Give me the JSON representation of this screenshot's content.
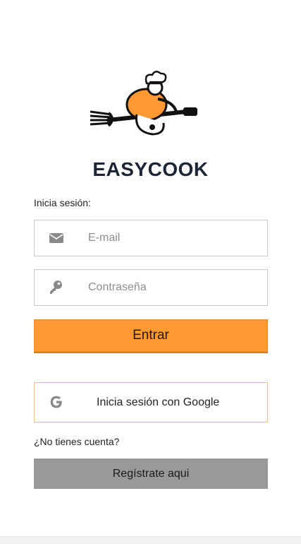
{
  "app": {
    "title": "EASYCOOK"
  },
  "login": {
    "label": "Inicia sesión:"
  },
  "email": {
    "placeholder": "E-mail",
    "icon": "envelope-icon"
  },
  "password": {
    "placeholder": "Contraseña",
    "icon": "key-icon"
  },
  "buttons": {
    "enter_label": "Entrar",
    "google_label": "Inicia sesión con Google",
    "register_label": "Regístrate aqui"
  },
  "signup": {
    "prompt": "¿No tienes cuenta?"
  },
  "colors": {
    "accent": "#ff9933",
    "title": "#1c2536",
    "register_bg": "#999999",
    "google_border": "#f3c07a"
  }
}
